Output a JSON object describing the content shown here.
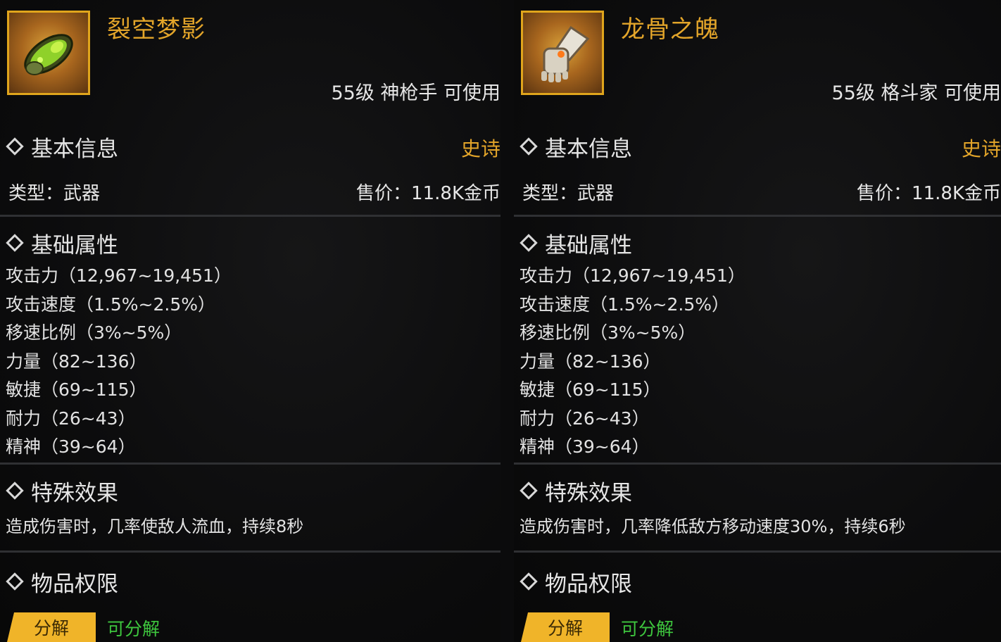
{
  "panels": [
    {
      "name": "裂空梦影",
      "requirement": "55级 神枪手 可使用",
      "rarity": "史诗",
      "basic_info_title": "基本信息",
      "type_label": "类型：武器",
      "price_label": "售价：11.8K金币",
      "attr_title": "基础属性",
      "attributes": [
        "攻击力（12,967~19,451）",
        "攻击速度（1.5%~2.5%）",
        "移速比例（3%~5%）",
        "力量（82~136）",
        "敏捷（69~115）",
        "耐力（26~43）",
        "精神（39~64）"
      ],
      "effect_title": "特殊效果",
      "effect_text": "造成伤害时，几率使敌人流血，持续8秒",
      "perm_title": "物品权限",
      "badge_label": "分解",
      "badge_status": "可分解",
      "icon": "gauntlet-green-icon"
    },
    {
      "name": "龙骨之魄",
      "requirement": "55级 格斗家 可使用",
      "rarity": "史诗",
      "basic_info_title": "基本信息",
      "type_label": "类型：武器",
      "price_label": "售价：11.8K金币",
      "attr_title": "基础属性",
      "attributes": [
        "攻击力（12,967~19,451）",
        "攻击速度（1.5%~2.5%）",
        "移速比例（3%~5%）",
        "力量（82~136）",
        "敏捷（69~115）",
        "耐力（26~43）",
        "精神（39~64）"
      ],
      "effect_title": "特殊效果",
      "effect_text": "造成伤害时，几率降低敌方移动速度30%，持续6秒",
      "perm_title": "物品权限",
      "badge_label": "分解",
      "badge_status": "可分解",
      "icon": "gauntlet-bone-icon"
    }
  ],
  "colors": {
    "gold": "#e3a52a",
    "badge": "#f0b429",
    "green": "#3ec63e",
    "text": "#e6e6e6",
    "divider": "#2f3033"
  }
}
